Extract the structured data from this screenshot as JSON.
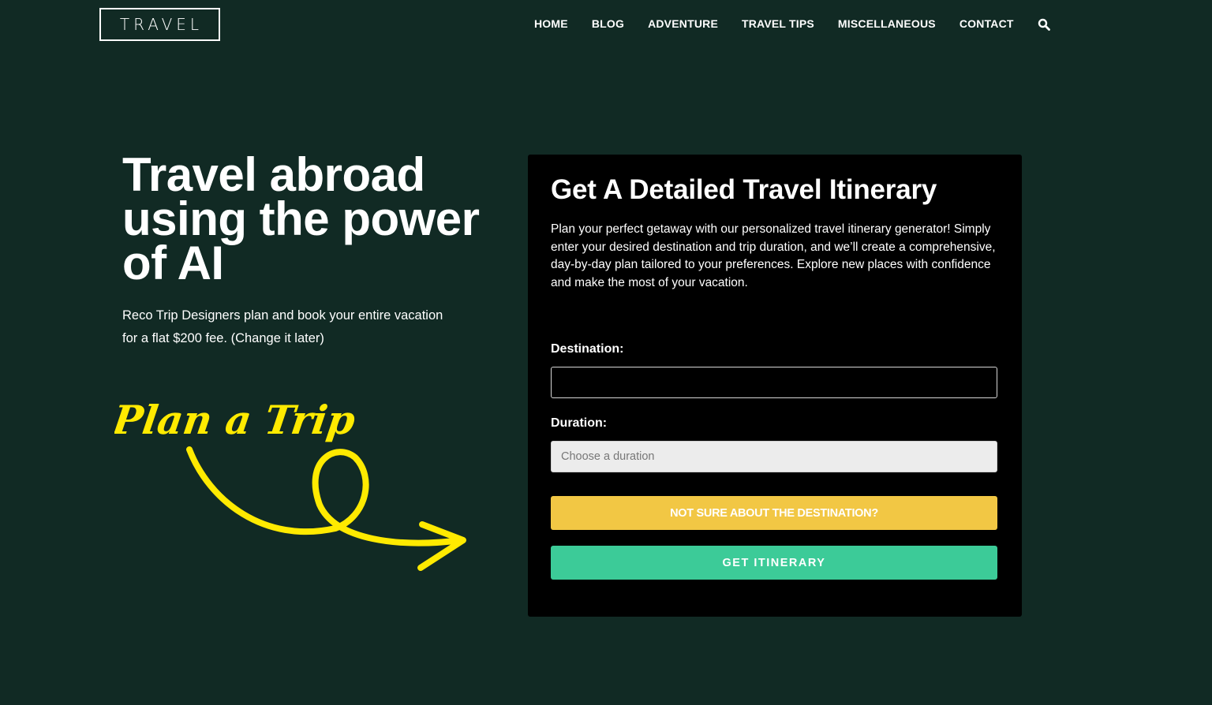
{
  "header": {
    "logo_text": "TRAVEL",
    "nav_items": [
      {
        "label": "HOME"
      },
      {
        "label": "BLOG"
      },
      {
        "label": "ADVENTURE"
      },
      {
        "label": "TRAVEL TIPS"
      },
      {
        "label": "MISCELLANEOUS"
      },
      {
        "label": "CONTACT"
      }
    ],
    "search_icon": "search-icon"
  },
  "hero": {
    "title_lines": [
      "Travel abroad",
      "using the power",
      "of AI"
    ],
    "subtitle_lines": [
      "Reco Trip Designers plan and book your entire vacation",
      "for a flat $200 fee. (Change it later)"
    ],
    "script_text": "Plan a Trip",
    "accent_color": "#ffea00"
  },
  "form": {
    "title": "Get A Detailed Travel Itinerary",
    "description": "Plan your perfect getaway with our personalized travel itinerary generator! Simply enter your desired destination and trip duration, and we’ll create a comprehensive, day-by-day plan tailored to your preferences. Explore new places with confidence and make the most of your vacation.",
    "destination_label": "Destination:",
    "destination_value": "",
    "duration_label": "Duration:",
    "duration_placeholder": "Choose a duration",
    "unsure_button": "NOT SURE ABOUT THE DESTINATION?",
    "get_button": "GET ITINERARY",
    "colors": {
      "unsure_button": "#f2c744",
      "get_button": "#3ccb98",
      "card_bg": "#000000",
      "page_bg": "#112a24"
    }
  }
}
